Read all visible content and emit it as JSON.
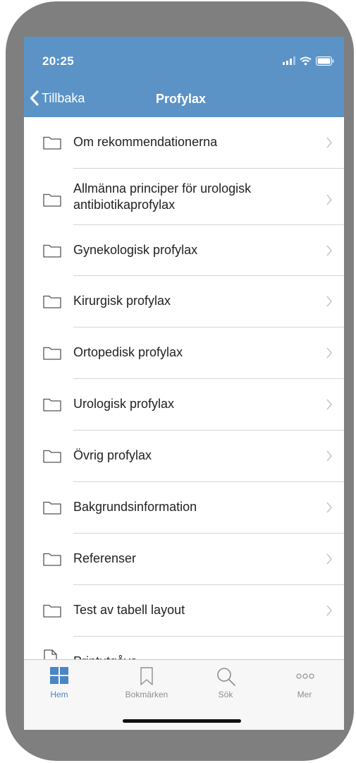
{
  "status": {
    "time": "20:25"
  },
  "nav": {
    "back_label": "Tillbaka",
    "title": "Profylax"
  },
  "items": [
    {
      "label": "Om rekommendationerna"
    },
    {
      "label": "Allmänna principer för urologisk antibiotikaprofylax"
    },
    {
      "label": "Gynekologisk profylax"
    },
    {
      "label": "Kirurgisk profylax"
    },
    {
      "label": "Ortopedisk profylax"
    },
    {
      "label": "Urologisk profylax"
    },
    {
      "label": "Övrig profylax"
    },
    {
      "label": "Bakgrundsinformation"
    },
    {
      "label": "Referenser"
    },
    {
      "label": "Test av tabell layout"
    },
    {
      "label": "Printutgåva"
    }
  ],
  "tabs": [
    {
      "label": "Hem",
      "icon": "grid-icon",
      "active": true
    },
    {
      "label": "Bokmärken",
      "icon": "bookmark-icon",
      "active": false
    },
    {
      "label": "Sök",
      "icon": "search-icon",
      "active": false
    },
    {
      "label": "Mer",
      "icon": "more-dots-icon",
      "active": false
    }
  ],
  "colors": {
    "header": "#5b93c7",
    "active_tab": "#4a86c5",
    "inactive_tab": "#8e8e93"
  }
}
